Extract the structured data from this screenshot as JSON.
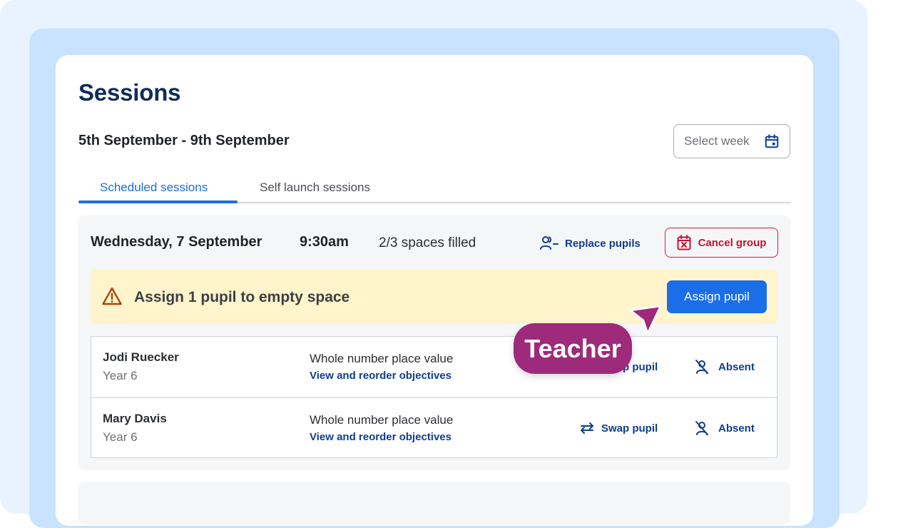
{
  "page": {
    "title": "Sessions",
    "date_range": "5th September - 9th September",
    "select_week_placeholder": "Select week"
  },
  "tabs": [
    {
      "label": "Scheduled sessions",
      "active": true
    },
    {
      "label": "Self launch sessions",
      "active": false
    }
  ],
  "session": {
    "day": "Wednesday, 7 September",
    "time": "9:30am",
    "spaces": "2/3 spaces filled",
    "replace_label": "Replace pupils",
    "cancel_label": "Cancel group",
    "alert_text": "Assign 1 pupil to empty space",
    "assign_label": "Assign pupil",
    "pupils": [
      {
        "name": "Jodi Ruecker",
        "year": "Year 6",
        "topic": "Whole number place value",
        "link": "View and reorder objectives",
        "swap": "Swap pupil",
        "absent": "Absent"
      },
      {
        "name": "Mary Davis",
        "year": "Year 6",
        "topic": "Whole number place value",
        "link": "View and reorder objectives",
        "swap": "Swap pupil",
        "absent": "Absent"
      }
    ]
  },
  "overlay": {
    "tag_label": "Teacher"
  },
  "colors": {
    "primary": "#1a6ee8",
    "navy": "#0f2b5b",
    "danger": "#c8102e",
    "warning_bg": "#fff4cc",
    "tag": "#9e2a7b"
  }
}
